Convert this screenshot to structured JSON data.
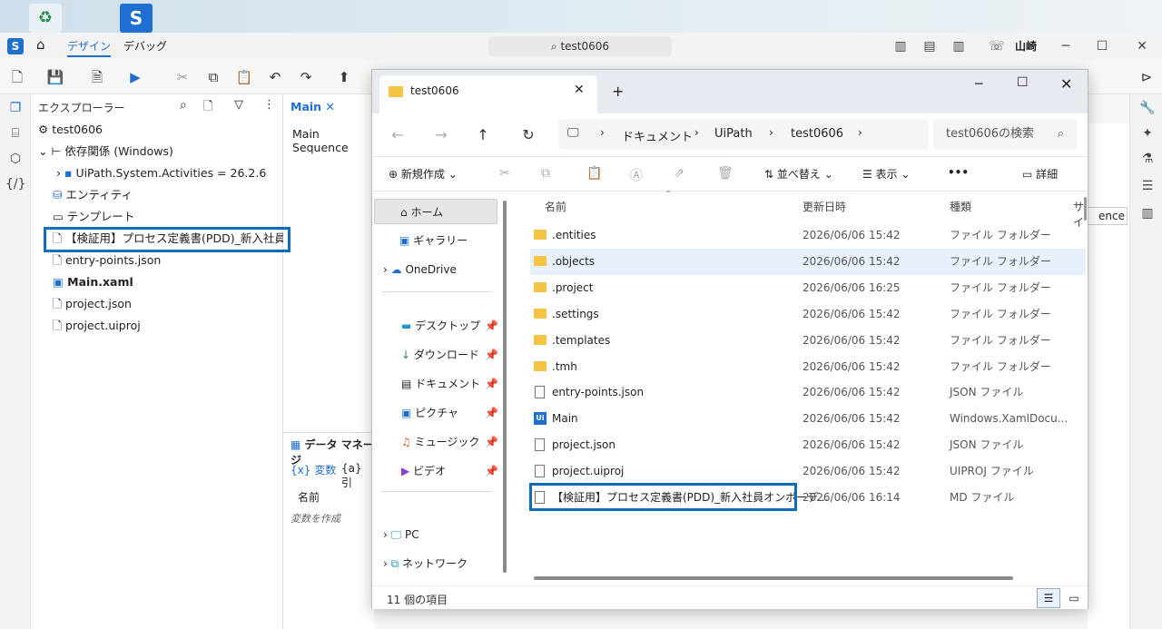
{
  "studio": {
    "tabs": {
      "design": "デザイン",
      "debug": "デバッグ"
    },
    "search": "test0606",
    "user": "山崎",
    "explorer_title": "エクスプローラー",
    "tree": {
      "root": "test0606",
      "deps": "依存関係 (Windows)",
      "dep1": "UiPath.System.Activities = 26.2.6",
      "entity": "エンティティ",
      "template": "テンプレート",
      "pdd": "【検証用】プロセス定義書(PDD)_新入社員オン",
      "entry": "entry-points.json",
      "main": "Main.xaml",
      "project": "project.json",
      "uiproj": "project.uiproj"
    },
    "designer": {
      "tab": "Main",
      "seq": "Main Sequence"
    },
    "data_manager": {
      "title": "データ マネージ",
      "vars": "変数",
      "args": "引",
      "col_name": "名前",
      "create": "変数を作成"
    },
    "right_partial": "ence"
  },
  "explorer": {
    "tab_title": "test0606",
    "breadcrumbs": [
      "ドキュメント",
      "UiPath",
      "test0606"
    ],
    "search_placeholder": "test0606の検索",
    "cmd": {
      "new": "新規作成",
      "sort": "並べ替え",
      "view": "表示",
      "details": "詳細"
    },
    "nav": {
      "home": "ホーム",
      "gallery": "ギャラリー",
      "onedrive": "OneDrive",
      "desktop": "デスクトップ",
      "downloads": "ダウンロード",
      "documents": "ドキュメント",
      "pictures": "ピクチャ",
      "music": "ミュージック",
      "videos": "ビデオ",
      "pc": "PC",
      "network": "ネットワーク"
    },
    "columns": {
      "name": "名前",
      "date": "更新日時",
      "type": "種類",
      "size": "サイ"
    },
    "files": [
      {
        "name": ".entities",
        "date": "2026/06/06 15:42",
        "type": "ファイル フォルダー"
      },
      {
        "name": ".objects",
        "date": "2026/06/06 15:42",
        "type": "ファイル フォルダー"
      },
      {
        "name": ".project",
        "date": "2026/06/06 16:25",
        "type": "ファイル フォルダー"
      },
      {
        "name": ".settings",
        "date": "2026/06/06 15:42",
        "type": "ファイル フォルダー"
      },
      {
        "name": ".templates",
        "date": "2026/06/06 15:42",
        "type": "ファイル フォルダー"
      },
      {
        "name": ".tmh",
        "date": "2026/06/06 15:42",
        "type": "ファイル フォルダー"
      },
      {
        "name": "entry-points.json",
        "date": "2026/06/06 15:42",
        "type": "JSON ファイル"
      },
      {
        "name": "Main",
        "date": "2026/06/06 15:42",
        "type": "Windows.XamlDocu..."
      },
      {
        "name": "project.json",
        "date": "2026/06/06 15:42",
        "type": "JSON ファイル"
      },
      {
        "name": "project.uiproj",
        "date": "2026/06/06 15:42",
        "type": "UIPROJ ファイル"
      },
      {
        "name": "【検証用】プロセス定義書(PDD)_新入社員オンボーデ...",
        "date": "2026/06/06 16:14",
        "type": "MD ファイル"
      }
    ],
    "status": "11 個の項目"
  }
}
